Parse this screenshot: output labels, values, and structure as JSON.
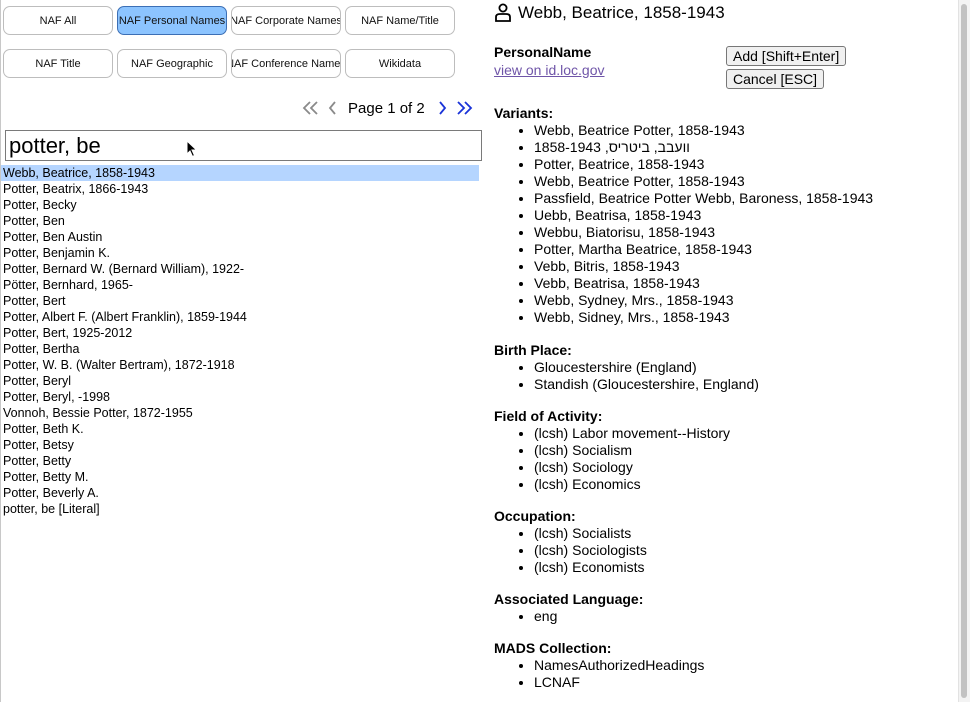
{
  "tabs": [
    {
      "label": "NAF All",
      "active": false
    },
    {
      "label": "NAF Personal Names",
      "active": true
    },
    {
      "label": "NAF Corporate Names",
      "active": false
    },
    {
      "label": "NAF Name/Title",
      "active": false
    },
    {
      "label": "NAF Title",
      "active": false
    },
    {
      "label": "NAF Geographic",
      "active": false
    },
    {
      "label": "NAF Conference Names",
      "active": false
    },
    {
      "label": "Wikidata",
      "active": false
    }
  ],
  "pager": {
    "text": "Page 1 of 2"
  },
  "search": {
    "value": "potter, be"
  },
  "results": [
    "Webb, Beatrice, 1858-1943",
    "Potter, Beatrix, 1866-1943",
    "Potter, Becky",
    "Potter, Ben",
    "Potter, Ben Austin",
    "Potter, Benjamin K.",
    "Potter, Bernard W. (Bernard William), 1922-",
    "Pötter, Bernhard, 1965-",
    "Potter, Bert",
    "Potter, Albert F. (Albert Franklin), 1859-1944",
    "Potter, Bert, 1925-2012",
    "Potter, Bertha",
    "Potter, W. B. (Walter Bertram), 1872-1918",
    "Potter, Beryl",
    "Potter, Beryl, -1998",
    "Vonnoh, Bessie Potter, 1872-1955",
    "Potter, Beth K.",
    "Potter, Betsy",
    "Potter, Betty",
    "Potter, Betty M.",
    "Potter, Beverly A.",
    "potter, be [Literal]"
  ],
  "selected_index": 0,
  "detail": {
    "title": "Webb, Beatrice, 1858-1943",
    "type_label": "PersonalName",
    "link_text": "view on id.loc.gov",
    "add_button": "Add [Shift+Enter]",
    "cancel_button": "Cancel [ESC]",
    "sections": [
      {
        "heading": "Variants:",
        "items": [
          "Webb, Beatrice Potter, 1858-1943",
          "וועבב, ביטריס, 1858-1943",
          "Potter, Beatrice, 1858-1943",
          "Webb, Beatrice Potter, 1858-1943",
          "Passfield, Beatrice Potter Webb, Baroness, 1858-1943",
          "Uebb, Beatrisa, 1858-1943",
          "Webbu, Biatorisu, 1858-1943",
          "Potter, Martha Beatrice, 1858-1943",
          "Vebb, Bitris, 1858-1943",
          "Vebb, Beatrisa, 1858-1943",
          "Webb, Sydney, Mrs., 1858-1943",
          "Webb, Sidney, Mrs., 1858-1943"
        ]
      },
      {
        "heading": "Birth Place:",
        "items": [
          "Gloucestershire (England)",
          "Standish (Gloucestershire, England)"
        ]
      },
      {
        "heading": "Field of Activity:",
        "items": [
          "(lcsh) Labor movement--History",
          "(lcsh) Socialism",
          "(lcsh) Sociology",
          "(lcsh) Economics"
        ]
      },
      {
        "heading": "Occupation:",
        "items": [
          "(lcsh) Socialists",
          "(lcsh) Sociologists",
          "(lcsh) Economists"
        ]
      },
      {
        "heading": "Associated Language:",
        "items": [
          "eng"
        ]
      },
      {
        "heading": "MADS Collection:",
        "items": [
          "NamesAuthorizedHeadings",
          "LCNAF"
        ]
      }
    ]
  }
}
